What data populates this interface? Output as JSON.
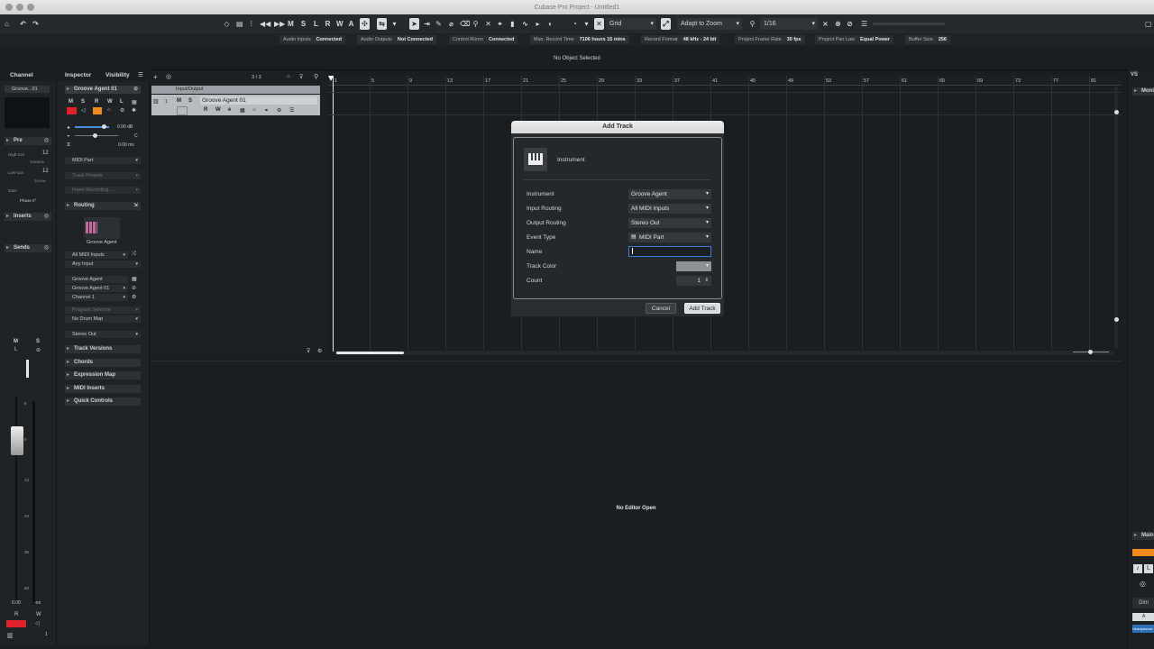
{
  "window": {
    "title": "Cubase Pro Project - Untitled1"
  },
  "toolbar": {
    "transport_buttons": [
      "M",
      "S",
      "L",
      "R",
      "W",
      "A"
    ],
    "grid_label": "Grid",
    "zoom_mode": "Adapt to Zoom",
    "quantize": "1/16"
  },
  "status": {
    "items": [
      {
        "label": "Audio Inputs",
        "value": "Connected"
      },
      {
        "label": "Audio Outputs",
        "value": "Not Connected"
      },
      {
        "label": "Control Room",
        "value": "Connected"
      },
      {
        "label": "Max. Record Time",
        "value": "7106 hours 15 mins"
      },
      {
        "label": "Record Format",
        "value": "48 kHz - 24 bit"
      },
      {
        "label": "Project Frame Rate",
        "value": "30 fps"
      },
      {
        "label": "Project Pan Law",
        "value": "Equal Power"
      },
      {
        "label": "Buffer Size",
        "value": "256"
      }
    ]
  },
  "info_line": "No Object Selected",
  "left_zone": {
    "tabs": {
      "channel": "Channel",
      "inspector": "Inspector",
      "visibility": "Visibility"
    },
    "channel": {
      "name": "Groove...01",
      "pre": "Pre",
      "high_cut_label": "High-Cut",
      "high_cut_value": "12",
      "high_cut_freq": "20000Hz",
      "low_cut_label": "Low-Cut",
      "low_cut_value": "12",
      "low_cut_freq": "20.0Hz",
      "gain": "Gain",
      "phase": "Phase 0°",
      "inserts": "Inserts",
      "sends": "Sends",
      "m": "M",
      "s": "S",
      "l": "L",
      "r": "R",
      "w": "W",
      "vol_left": "0.00",
      "vol_right": "-oo",
      "channel_num": "1"
    },
    "inspector": {
      "track_name": "Groove Agent 01",
      "mute": "M",
      "solo": "S",
      "read": "R",
      "write": "W",
      "lanes": "L",
      "volume": "0.00 dB",
      "pan": "C",
      "delay": "0.00 ms",
      "midi_part": "MIDI Part",
      "track_presets": "Track Presets",
      "insert_recording": "Insert Recording...",
      "routing": "Routing",
      "instrument_name": "Groove Agent",
      "input": "All MIDI Inputs",
      "input_channel": "Any Input",
      "output_device": "Groove Agent",
      "output_instance": "Groove Agent 01",
      "output_channel": "Channel 1",
      "program_selector": "Program Selector",
      "drum_map": "No Drum Map",
      "audio_output": "Stereo Out",
      "sections": [
        "Track Versions",
        "Chords",
        "Expression Map",
        "MIDI Inserts",
        "Quick Controls"
      ]
    }
  },
  "track_list": {
    "counter": "3 / 3",
    "folder": "Input/Output",
    "track_name": "Groove Agent 01",
    "track_num": "1",
    "m": "M",
    "s": "S",
    "r": "R",
    "w": "W",
    "e": "e"
  },
  "ruler": {
    "bars": [
      "1",
      "5",
      "9",
      "13",
      "17",
      "21",
      "25",
      "29",
      "33",
      "37",
      "41",
      "45",
      "49",
      "53",
      "57",
      "61",
      "65",
      "69",
      "73",
      "77",
      "81"
    ]
  },
  "dialog": {
    "title": "Add Track",
    "track_type": "Instrument",
    "fields": {
      "instrument_label": "Instrument",
      "instrument_value": "Groove Agent",
      "input_label": "Input Routing",
      "input_value": "All MIDI Inputs",
      "output_label": "Output Routing",
      "output_value": "Stereo Out",
      "event_label": "Event Type",
      "event_value": "MIDI Part",
      "name_label": "Name",
      "name_value": "",
      "color_label": "Track Color",
      "count_label": "Count",
      "count_value": "1"
    },
    "cancel": "Cancel",
    "add": "Add Track"
  },
  "lower_zone": {
    "message": "No Editor Open"
  },
  "right_zone": {
    "vs": "VS",
    "monitor": "Moni",
    "main": "Main",
    "dim": "Dim",
    "a": "A",
    "headphones": "Headphones"
  },
  "colors": {
    "record": "#e0202a",
    "accent_orange": "#f08a1e",
    "focus_blue": "#3a7bd5"
  }
}
